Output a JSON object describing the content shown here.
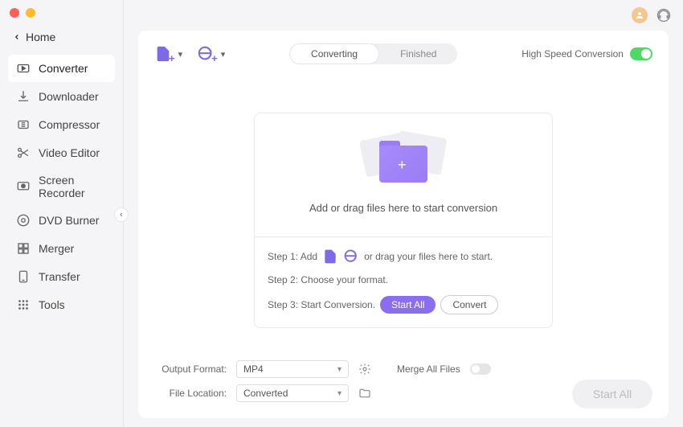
{
  "home": "Home",
  "sidebar": [
    {
      "label": "Converter",
      "icon": "converter"
    },
    {
      "label": "Downloader",
      "icon": "downloader"
    },
    {
      "label": "Compressor",
      "icon": "compressor"
    },
    {
      "label": "Video Editor",
      "icon": "editor"
    },
    {
      "label": "Screen Recorder",
      "icon": "recorder"
    },
    {
      "label": "DVD Burner",
      "icon": "dvd"
    },
    {
      "label": "Merger",
      "icon": "merger"
    },
    {
      "label": "Transfer",
      "icon": "transfer"
    },
    {
      "label": "Tools",
      "icon": "tools"
    }
  ],
  "tabs": {
    "converting": "Converting",
    "finished": "Finished"
  },
  "high_speed": "High Speed Conversion",
  "drop_zone": {
    "main_text": "Add or drag files here to start conversion",
    "step1_a": "Step 1: Add",
    "step1_b": "or drag your files here to start.",
    "step2": "Step 2: Choose your format.",
    "step3": "Step 3: Start Conversion.",
    "start_all_btn": "Start  All",
    "convert_btn": "Convert"
  },
  "footer": {
    "output_format_label": "Output Format:",
    "output_format_value": "MP4",
    "file_location_label": "File Location:",
    "file_location_value": "Converted",
    "merge_label": "Merge All Files",
    "start_all": "Start All"
  }
}
